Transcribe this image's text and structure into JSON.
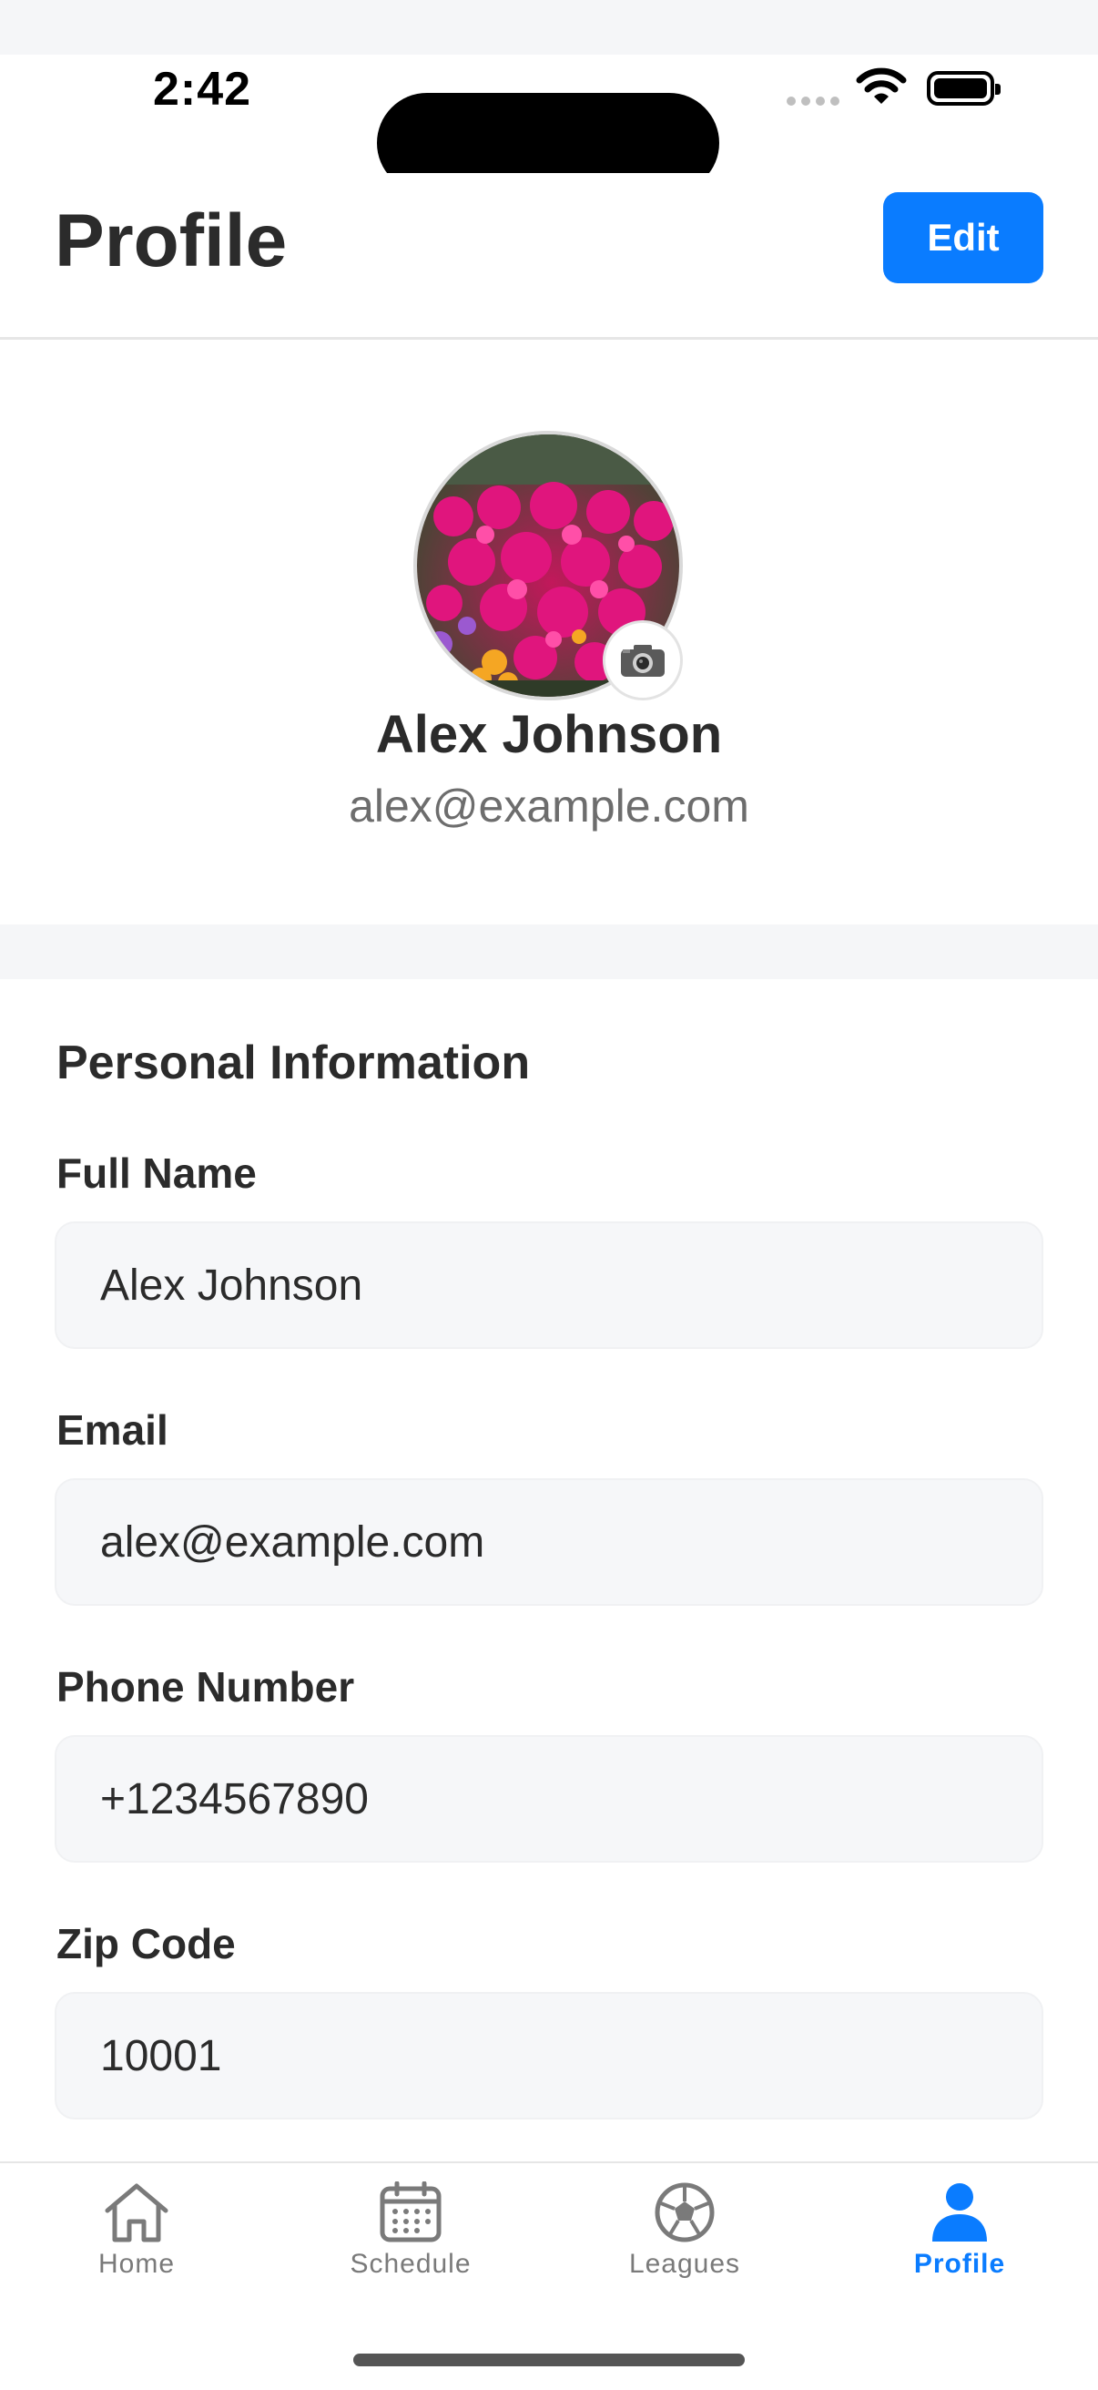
{
  "status_bar": {
    "time": "2:42"
  },
  "header": {
    "title": "Profile",
    "edit_label": "Edit"
  },
  "profile": {
    "name": "Alex Johnson",
    "email": "alex@example.com"
  },
  "personal_info": {
    "section_title": "Personal Information",
    "fields": [
      {
        "label": "Full Name",
        "value": "Alex Johnson"
      },
      {
        "label": "Email",
        "value": "alex@example.com"
      },
      {
        "label": "Phone Number",
        "value": "+1234567890"
      },
      {
        "label": "Zip Code",
        "value": "10001"
      }
    ]
  },
  "tabbar": {
    "items": [
      {
        "label": "Home",
        "icon": "home-icon"
      },
      {
        "label": "Schedule",
        "icon": "calendar-icon"
      },
      {
        "label": "Leagues",
        "icon": "soccer-ball-icon"
      },
      {
        "label": "Profile",
        "icon": "person-icon",
        "active": true
      }
    ]
  },
  "colors": {
    "accent": "#0a7cff",
    "text": "#2b2b2b",
    "muted": "#6d6d6d",
    "field_bg": "#f6f7f9"
  }
}
